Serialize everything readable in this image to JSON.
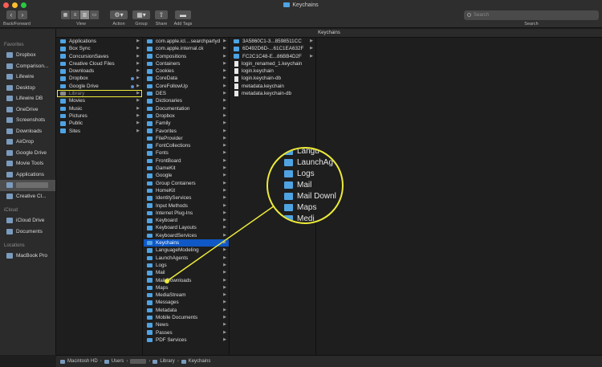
{
  "window": {
    "title": "Keychains"
  },
  "toolbar": {
    "back_forward_label": "Back/Forward",
    "view_label": "View",
    "action_label": "Action",
    "group_label": "Group",
    "share_label": "Share",
    "add_tags_label": "Add Tags",
    "search_label": "Search",
    "search_placeholder": "Search"
  },
  "column_header": "Keychains",
  "sidebar": {
    "favorites_label": "Favorites",
    "favorites": [
      "Dropbox",
      "Comparison...",
      "Lifewire",
      "Desktop",
      "Lifewire DB",
      "OneDrive",
      "Screenshots",
      "Downloads",
      "AirDrop",
      "Google Drive",
      "Movie Tools",
      "Applications",
      "",
      "Creative Cl..."
    ],
    "icloud_label": "iCloud",
    "icloud": [
      "iCloud Drive",
      "Documents"
    ],
    "locations_label": "Locations",
    "locations": [
      "MacBook Pro"
    ]
  },
  "columns": {
    "home": [
      "Applications",
      "Box Sync",
      "ConcursionSaves",
      "Creative Cloud Files",
      "Downloads",
      "Dropbox",
      "Google Drive",
      "Library",
      "Movies",
      "Music",
      "Pictures",
      "Public",
      "Sites"
    ],
    "library": [
      "com.apple.icl....searchpartyd",
      "com.apple.internal.ck",
      "Compositions",
      "Containers",
      "Cookies",
      "CoreData",
      "CoreFollowUp",
      "DES",
      "Dictionaries",
      "Documentation",
      "Dropbox",
      "Family",
      "Favorites",
      "FileProvider",
      "FontCollections",
      "Fonts",
      "FrontBoard",
      "GameKit",
      "Google",
      "Group Containers",
      "HomeKit",
      "IdentityServices",
      "Input Methods",
      "Internet Plug-Ins",
      "Keyboard",
      "Keyboard Layouts",
      "KeyboardServices",
      "Keychains",
      "LanguageModeling",
      "LaunchAgents",
      "Logs",
      "Mail",
      "Mail Downloads",
      "Maps",
      "MediaStream",
      "Messages",
      "Metadata",
      "Mobile Documents",
      "News",
      "Passes",
      "PDF Services"
    ],
    "keychains_folders": [
      "3A5860C1-3...8598511CC",
      "6D492D6D-...61C1EA632F",
      "FC2C1C48-E...86BB4D2F"
    ],
    "keychains_files": [
      "login_renamed_1.keychain",
      "login.keychain",
      "login.keychain-db",
      "metadata.keychain",
      "metadata.keychain-db"
    ]
  },
  "magnifier": [
    "Langu",
    "LaunchAg",
    "Logs",
    "Mail",
    "Mail Downl",
    "Maps",
    "Medi"
  ],
  "path_bar": [
    "Macintosh HD",
    "Users",
    "Library",
    "Keychains"
  ],
  "colors": {
    "folder": "#4fa3e3",
    "selection": "#0f58c5",
    "highlight": "#ecea3a"
  }
}
